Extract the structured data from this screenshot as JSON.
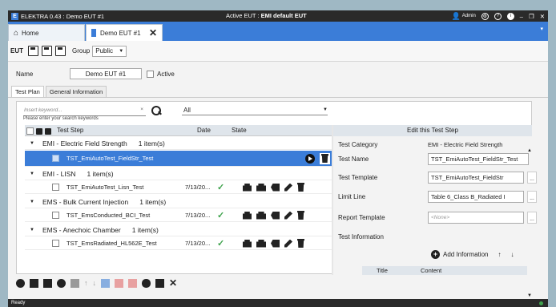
{
  "window": {
    "title": "ELEKTRA 0.43 : Demo EUT #1",
    "active_eut_prefix": "Active EUT : ",
    "active_eut_value": "EMI default EUT",
    "user": "Admin",
    "minimize": "–",
    "restore": "❐",
    "close": "✕"
  },
  "tabs": [
    {
      "label": "Home"
    },
    {
      "label": "Demo EUT #1"
    }
  ],
  "toolbar": {
    "section_label": "EUT",
    "group_label": "Group",
    "group_value": "Public"
  },
  "form": {
    "name_label": "Name",
    "name_value": "Demo EUT #1",
    "active_label": "Active"
  },
  "subtabs": [
    {
      "label": "Test Plan"
    },
    {
      "label": "General Information"
    }
  ],
  "search": {
    "placeholder": "Insert keyword...",
    "hint": "Please enter your search keywords",
    "clear": "×",
    "filter_value": "All"
  },
  "grid": {
    "headers": {
      "step": "Test Step",
      "date": "Date",
      "state": "State"
    },
    "groups": [
      {
        "title": "EMI - Electric Field Strength",
        "count": "1 item(s)",
        "items": [
          {
            "name": "TST_EmiAutoTest_FieldStr_Test",
            "date": "",
            "state": ""
          }
        ]
      },
      {
        "title": "EMI - LISN",
        "count": "1 item(s)",
        "items": [
          {
            "name": "TST_EmiAutoTest_Lisn_Test",
            "date": "7/13/20...",
            "state": "✓"
          }
        ]
      },
      {
        "title": "EMS - Bulk Current Injection",
        "count": "1 item(s)",
        "items": [
          {
            "name": "TST_EmsConducted_BCI_Test",
            "date": "7/13/20...",
            "state": "✓"
          }
        ]
      },
      {
        "title": "EMS - Anechoic Chamber",
        "count": "1 item(s)",
        "items": [
          {
            "name": "TST_EmsRadiated_HL562E_Test",
            "date": "7/13/20...",
            "state": "✓"
          }
        ]
      }
    ]
  },
  "edit_panel": {
    "title": "Edit this Test Step",
    "category_label": "Test Category",
    "category_value": "EMI - Electric Field Strength",
    "name_label": "Test Name",
    "name_value": "TST_EmiAutoTest_FieldStr_Test",
    "template_label": "Test Template",
    "template_value": "TST_EmiAutoTest_FieldStr",
    "limit_label": "Limit Line",
    "limit_value": "Table 6_Class B_Radiated I",
    "report_label": "Report Template",
    "report_value": "<None>",
    "info_label": "Test Information",
    "add_info_label": "Add Information",
    "info_col_title": "Title",
    "info_col_content": "Content",
    "more": "..."
  },
  "status": {
    "text": "Ready"
  },
  "colors": {
    "accent": "#3b7dd8",
    "titlebar": "#2a2a2a",
    "ok": "#3fa34d"
  }
}
